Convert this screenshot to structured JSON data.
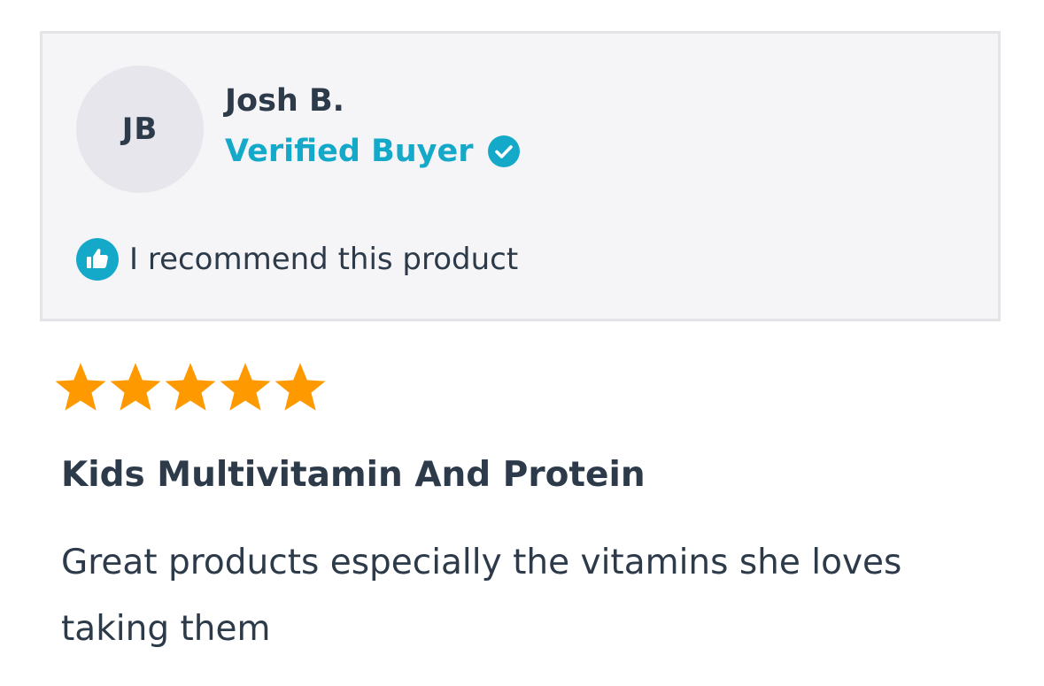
{
  "reviewer": {
    "initials": "JB",
    "name": "Josh B.",
    "badge": "Verified Buyer",
    "recommendation": "I recommend this product"
  },
  "review": {
    "rating": 5,
    "max_rating": 5,
    "title": "Kids Multivitamin And Protein",
    "body": "Great products especially the vitamins she loves taking them"
  },
  "icons": {
    "verified": "check-circle-icon",
    "recommend": "thumbs-up-icon",
    "rating": "star-icon"
  },
  "colors": {
    "accent": "#15a9c9",
    "text": "#2c3a4a",
    "star": "#ff9900",
    "card_bg": "#f5f5f7",
    "card_border": "#e4e4e8",
    "avatar_bg": "#e6e6ec"
  }
}
